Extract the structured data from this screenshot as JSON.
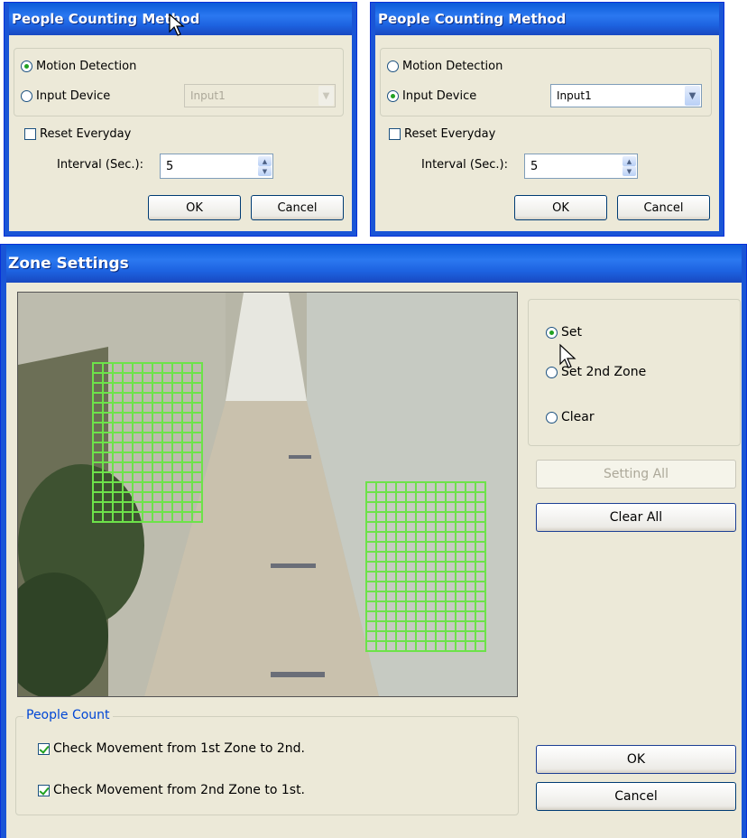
{
  "dialog_motion": {
    "title": "People Counting Method",
    "radio_motion": "Motion Detection",
    "radio_input": "Input Device",
    "input_value": "Input1",
    "reset_everyday": "Reset Everyday",
    "interval_label": "Interval (Sec.):",
    "interval_value": "5",
    "ok": "OK",
    "cancel": "Cancel"
  },
  "dialog_input": {
    "title": "People Counting Method",
    "radio_motion": "Motion Detection",
    "radio_input": "Input Device",
    "input_value": "Input1",
    "reset_everyday": "Reset Everyday",
    "interval_label": "Interval (Sec.):",
    "interval_value": "5",
    "ok": "OK",
    "cancel": "Cancel"
  },
  "zone": {
    "title": "Zone Settings",
    "radio_set": "Set",
    "radio_set2": "Set 2nd Zone",
    "radio_clear": "Clear",
    "setting_all": "Setting All",
    "clear_all": "Clear All",
    "people_count_label": "People Count",
    "check1": "Check Movement from 1st Zone to 2nd.",
    "check2": "Check Movement from 2nd Zone to 1st.",
    "ok": "OK",
    "cancel": "Cancel"
  },
  "colors": {
    "titlebar": "#0a5bd8",
    "zone_grid": "#6de24a",
    "selected_radio": "#21a121"
  }
}
